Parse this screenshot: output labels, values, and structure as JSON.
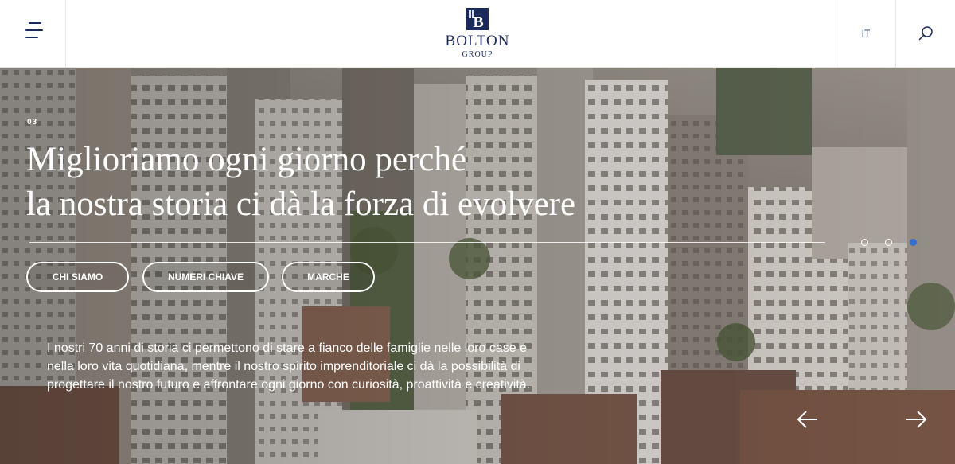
{
  "header": {
    "logo": {
      "name": "BOLTON",
      "sub": "GROUP",
      "mark_letter": "B"
    },
    "language": "IT",
    "menu_icon": "hamburger-icon",
    "search_icon": "search-icon"
  },
  "hero": {
    "slide_number": "03",
    "headline": {
      "line1": "Miglioriamo ogni giorno perché",
      "line2": "la nostra storia ci dà la forza di evolvere"
    },
    "buttons": [
      "CHI SIAMO",
      "NUMERI CHIAVE",
      "MARCHE"
    ],
    "description": "I nostri 70 anni di storia ci permettono di stare a fianco delle famiglie nelle loro case e nella loro vita quotidiana, mentre il nostro spirito imprenditoriale ci dà la possibilità di progettare il nostro futuro e affrontare ogni giorno con curiosità, proattività e creatività.",
    "slider": {
      "total_dots": 3,
      "active_dot": 3
    },
    "prev_icon": "arrow-left-icon",
    "next_icon": "arrow-right-icon"
  },
  "colors": {
    "brand_navy": "#1b2a5c",
    "accent_blue": "#2f6fd6",
    "white": "#ffffff"
  }
}
